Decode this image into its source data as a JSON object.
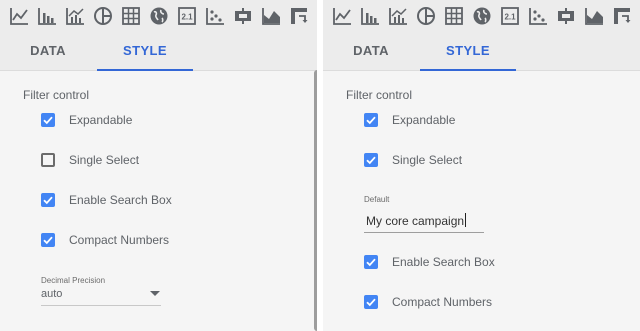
{
  "left_panel": {
    "tabs": [
      {
        "label": "DATA",
        "active": false
      },
      {
        "label": "STYLE",
        "active": true
      }
    ],
    "section_title": "Filter control",
    "checkboxes": [
      {
        "label": "Expandable",
        "checked": true
      },
      {
        "label": "Single Select",
        "checked": false
      },
      {
        "label": "Enable Search Box",
        "checked": true
      },
      {
        "label": "Compact Numbers",
        "checked": true
      }
    ],
    "decimal_precision": {
      "label": "Decimal Precision",
      "value": "auto"
    }
  },
  "right_panel": {
    "tabs": [
      {
        "label": "DATA",
        "active": false
      },
      {
        "label": "STYLE",
        "active": true
      }
    ],
    "section_title": "Filter control",
    "checkboxes": [
      {
        "label": "Expandable",
        "checked": true
      },
      {
        "label": "Single Select",
        "checked": true
      },
      {
        "label": "Enable Search Box",
        "checked": true
      },
      {
        "label": "Compact Numbers",
        "checked": true
      }
    ],
    "default_field": {
      "label": "Default",
      "value": "My core campaign"
    }
  },
  "toolbar_icons": [
    "line-chart-icon",
    "bar-chart-icon",
    "combo-chart-icon",
    "pie-chart-icon",
    "table-icon",
    "geo-map-icon",
    "scorecard-icon",
    "scatter-chart-icon",
    "bullet-chart-icon",
    "area-chart-icon",
    "pivot-table-icon"
  ],
  "scorecard_icon_text": "2.1",
  "colors": {
    "accent": "#3367d6",
    "checkbox": "#4285f4",
    "panel_bg": "#f5f5f5",
    "icon": "#5f6368"
  }
}
